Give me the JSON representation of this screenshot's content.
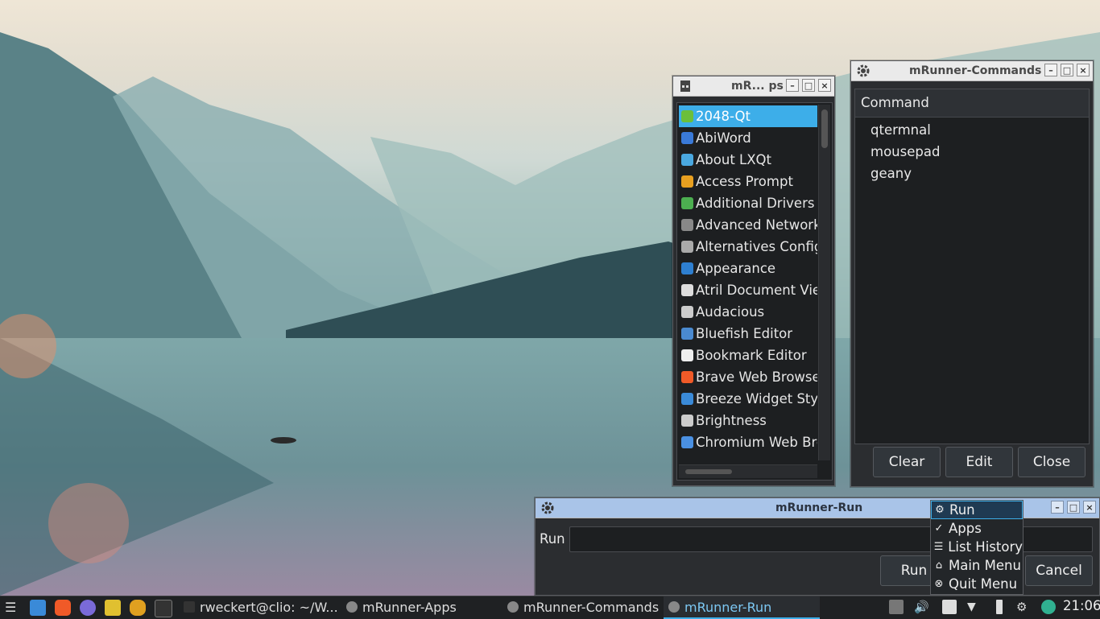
{
  "apps_window": {
    "title": "mR... ps",
    "items": [
      {
        "label": "2048-Qt",
        "color": "#6bbf3a"
      },
      {
        "label": "AbiWord",
        "color": "#3a7ad8"
      },
      {
        "label": "About LXQt",
        "color": "#4aa8e0"
      },
      {
        "label": "Access Prompt",
        "color": "#e8a020"
      },
      {
        "label": "Additional Drivers",
        "color": "#4caf50"
      },
      {
        "label": "Advanced Network",
        "color": "#888888"
      },
      {
        "label": "Alternatives Config",
        "color": "#aaaaaa"
      },
      {
        "label": "Appearance",
        "color": "#2e7fd0"
      },
      {
        "label": "Atril Document Vie",
        "color": "#dddddd"
      },
      {
        "label": "Audacious",
        "color": "#cccccc"
      },
      {
        "label": "Bluefish Editor",
        "color": "#4a8ad0"
      },
      {
        "label": "Bookmark Editor",
        "color": "#eeeeee"
      },
      {
        "label": "Brave Web Browse",
        "color": "#f05a28"
      },
      {
        "label": "Breeze Widget Styl",
        "color": "#3a8ad8"
      },
      {
        "label": "Brightness",
        "color": "#cccccc"
      },
      {
        "label": "Chromium Web Bro",
        "color": "#4a90e2"
      }
    ],
    "selected_index": 0
  },
  "commands_window": {
    "title": "mRunner-Commands",
    "header": "Command",
    "items": [
      "qtermnal",
      "mousepad",
      "geany"
    ],
    "buttons": {
      "clear": "Clear",
      "edit": "Edit",
      "close": "Close"
    }
  },
  "run_window": {
    "title": "mRunner-Run",
    "field_label": "Run",
    "input_value": "",
    "run_button": "Run",
    "cancel_button": "Cancel"
  },
  "context_menu": {
    "items": [
      {
        "label": "Run",
        "icon": "gear-icon",
        "glyph": "⚙"
      },
      {
        "label": "Apps",
        "icon": "check-icon",
        "glyph": "✓"
      },
      {
        "label": "List History",
        "icon": "list-icon",
        "glyph": "☰"
      },
      {
        "label": "Main Menu",
        "icon": "home-icon",
        "glyph": "⌂"
      },
      {
        "label": "Quit Menu",
        "icon": "close-circle-icon",
        "glyph": "⊗"
      }
    ],
    "highlighted_index": 0
  },
  "taskbar": {
    "tasks": [
      {
        "label": "rweckert@clio: ~/W...",
        "active": false
      },
      {
        "label": "mRunner-Apps",
        "active": false
      },
      {
        "label": "mRunner-Commands",
        "active": false
      },
      {
        "label": "mRunner-Run",
        "active": true
      }
    ],
    "clock": "21:06"
  },
  "colors": {
    "accent": "#3daee9",
    "window_bg": "#2b2d30",
    "list_bg": "#1d1f21"
  }
}
